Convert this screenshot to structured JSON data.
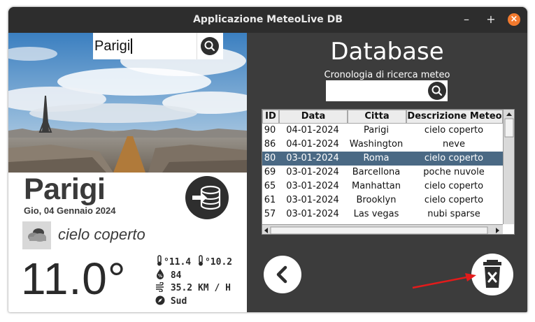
{
  "window": {
    "title": "Applicazione MeteoLive DB",
    "minimize": "–",
    "maximize": "+",
    "close": "×"
  },
  "search": {
    "value": "Parigi"
  },
  "weather": {
    "city": "Parigi",
    "date": "Gio, 04 Gennaio 2024",
    "description": "cielo coperto",
    "temperature": "11.0°",
    "temp_max": "11.4",
    "temp_min": "10.2",
    "humidity": "84",
    "wind": "35.2 KM / H",
    "wind_direction": "Sud"
  },
  "database": {
    "title": "Database",
    "subtitle": "Cronologia di ricerca meteo",
    "search_value": "",
    "columns": [
      "ID",
      "Data",
      "Citta",
      "Descrizione Meteo"
    ],
    "rows": [
      {
        "id": "90",
        "data": "04-01-2024",
        "citta": "Parigi",
        "descrizione": "cielo coperto",
        "selected": false
      },
      {
        "id": "86",
        "data": "04-01-2024",
        "citta": "Washington",
        "descrizione": "neve",
        "selected": false
      },
      {
        "id": "80",
        "data": "03-01-2024",
        "citta": "Roma",
        "descrizione": "cielo coperto",
        "selected": true
      },
      {
        "id": "69",
        "data": "03-01-2024",
        "citta": "Barcellona",
        "descrizione": "poche nuvole",
        "selected": false
      },
      {
        "id": "65",
        "data": "03-01-2024",
        "citta": "Manhattan",
        "descrizione": "cielo coperto",
        "selected": false
      },
      {
        "id": "61",
        "data": "03-01-2024",
        "citta": "Brooklyn",
        "descrizione": "cielo coperto",
        "selected": false
      },
      {
        "id": "57",
        "data": "03-01-2024",
        "citta": "Las vegas",
        "descrizione": "nubi sparse",
        "selected": false
      }
    ]
  },
  "icons": {
    "search": "search-icon",
    "database": "database-import-icon",
    "weather": "cloud-icon",
    "back": "chevron-left-icon",
    "delete": "trash-icon",
    "annotation": "red-arrow"
  },
  "colors": {
    "window_bg": "#3c3c3c",
    "titlebar": "#2d2d2d",
    "close_button": "#f27a2e",
    "selected_row": "#4a6984",
    "annotation_arrow": "#e31b1b"
  }
}
